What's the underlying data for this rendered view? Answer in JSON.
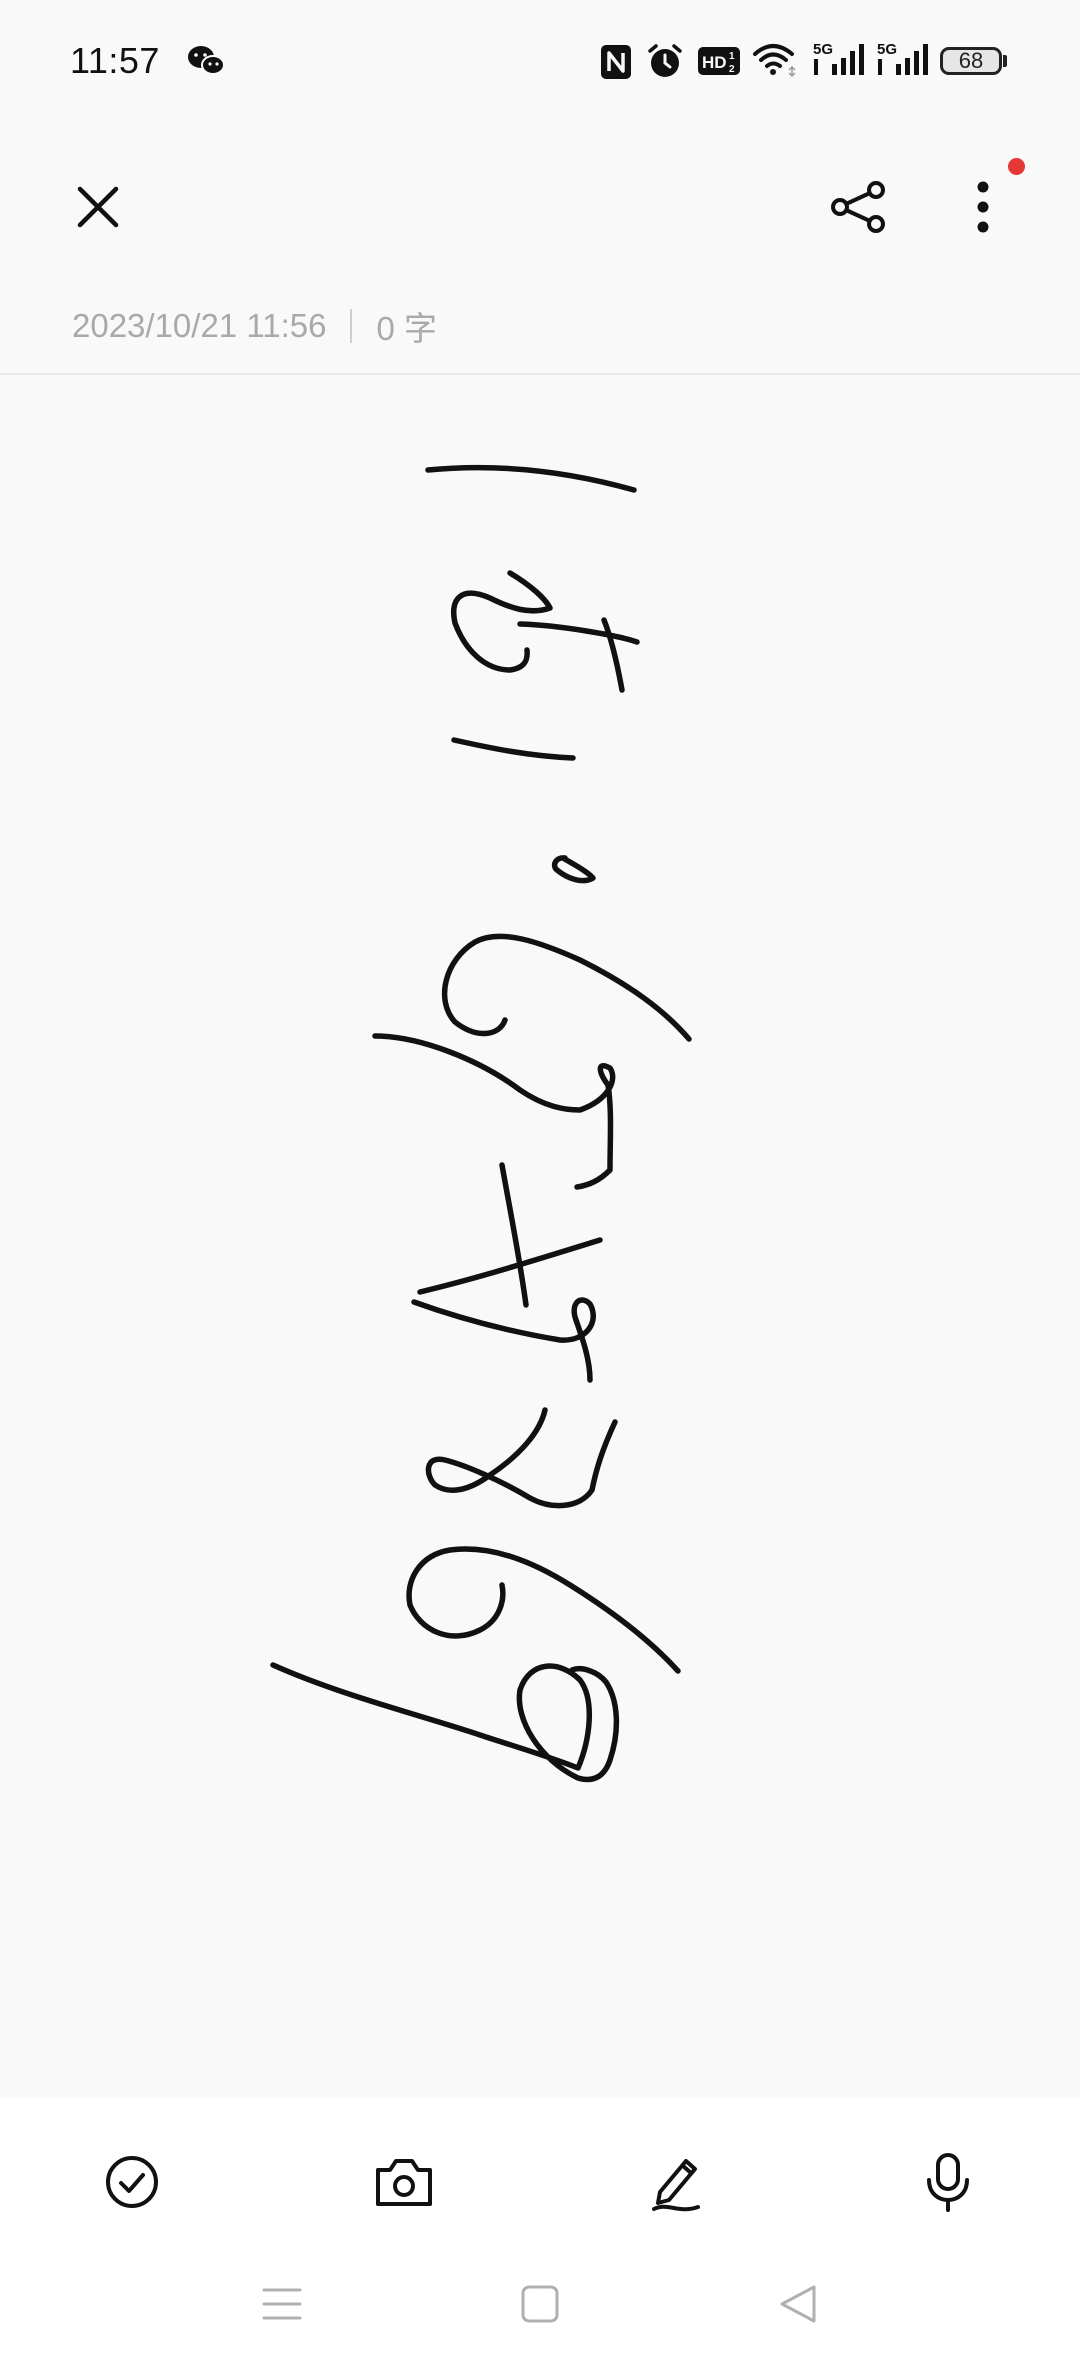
{
  "status_bar": {
    "time": "11:57",
    "battery_level": "68",
    "icons": [
      "wechat-icon",
      "nfc-icon",
      "alarm-icon",
      "hd-icon",
      "wifi-icon",
      "signal-5g-icon",
      "signal-5g-icon",
      "battery-icon"
    ]
  },
  "toolbar": {
    "icons": [
      "close-icon",
      "share-icon",
      "more-icon"
    ],
    "has_notification": true
  },
  "note": {
    "timestamp": "2023/10/21 11:56",
    "word_count": "0 字"
  },
  "bottom_toolbar": {
    "icons": [
      "checklist-icon",
      "camera-icon",
      "pen-icon",
      "microphone-icon"
    ]
  },
  "nav_bar": {
    "icons": [
      "recents-icon",
      "home-icon",
      "back-icon"
    ]
  },
  "colors": {
    "background": "#f9f9f9",
    "ink": "#111111",
    "meta_text": "#a9a9a9",
    "notification": "#e53935"
  }
}
